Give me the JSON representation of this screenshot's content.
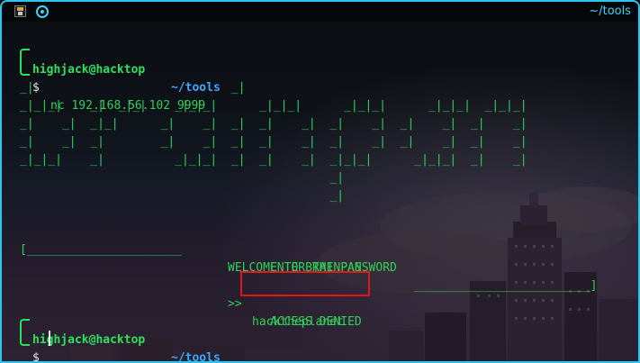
{
  "window": {
    "title": "~/tools"
  },
  "terminal": {
    "prompt1": {
      "user_host": "highjack@hacktop",
      "path": "~/tools",
      "symbol": "$",
      "command": "nc 192.168.56.102 9999"
    },
    "ascii_art": [
      "_|                            _|",
      "_|_|_|    _|  _|_|    _|_|_|      _|_|_|      _|_|_|      _|_|_|  _|_|_|",
      "_|    _|  _|_|      _|    _|  _|  _|    _|  _|    _|  _|    _|  _|    _|",
      "_|    _|  _|        _|    _|  _|  _|    _|  _|    _|  _|    _|  _|    _|",
      "_|_|_|    _|          _|_|_|  _|  _|    _|  _|_|_|      _|_|_|  _|    _|",
      "                                            _|",
      "                                            _|"
    ],
    "banner_left": "[______________________",
    "banner_title": "WELCOME TO BRAINPAN",
    "banner_right": "_________________________]",
    "enter_password": "ENTER THE PASSWORD",
    "input_marker": ">>",
    "password_entered": "hacktheplanet",
    "response": "ACCESS DENIED",
    "prompt2": {
      "user_host": "highjack@hacktop",
      "path": "~/tools",
      "symbol": "$"
    }
  },
  "colors": {
    "frame_accent": "#2fc4ee",
    "terminal_green": "#2ed158",
    "prompt_user": "#2ee05e",
    "prompt_path": "#3fa6ff",
    "highlight_box": "#e0181c"
  },
  "icons": [
    "terminal-app-icon",
    "pin-icon"
  ]
}
